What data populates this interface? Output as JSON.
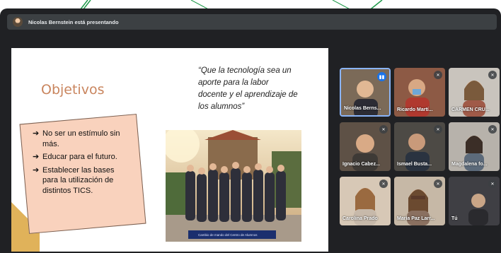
{
  "banner": {
    "presenter_text": "Nicolas Bernstein está presentando"
  },
  "slide": {
    "title": "Objetivos",
    "quote_lines": [
      "“Que la tecnología sea un",
      "aporte para la labor",
      "docente y el aprendizaje de",
      "los alumnos”"
    ],
    "bullets": [
      {
        "line1": "No ser un estímulo sin",
        "line2": "más."
      },
      {
        "line1": "Educar para el futuro.",
        "line2": ""
      },
      {
        "line1": "Establecer las bases",
        "line2": "para la utilización de",
        "line3": "distintos TICS."
      }
    ],
    "photo_caption": {
      "line1": "",
      "line2": "Cambio de mando del Centro de Alumnos"
    }
  },
  "participants": [
    {
      "name": "Nicolas Berns..."
    },
    {
      "name": "Ricardo Martí..."
    },
    {
      "name": "CARMEN CRU..."
    },
    {
      "name": "Ignacio Cabez..."
    },
    {
      "name": "Ismael Busta..."
    },
    {
      "name": "Magdalena fo..."
    },
    {
      "name": "Carolina Prado"
    },
    {
      "name": "María Paz Larr..."
    },
    {
      "name": "Tú"
    }
  ],
  "colors": {
    "accent": "#1a73e8",
    "slide_title": "#c9855e",
    "bullet_box": "#f9d2bd",
    "window_bg": "#202124"
  }
}
